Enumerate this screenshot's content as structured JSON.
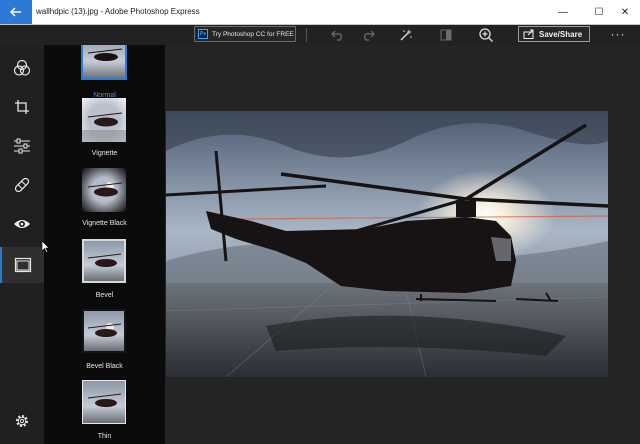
{
  "window": {
    "title": "wallhdpic (13).jpg - Adobe Photoshop Express",
    "minimize": "—",
    "maximize": "☐",
    "close": "✕"
  },
  "toolbar": {
    "try_badge": "Ps",
    "try_label": "Try Photoshop CC for FREE",
    "save_label": "Save/Share",
    "more": "···"
  },
  "icons": {
    "back": "back-arrow-icon",
    "undo": "undo-icon",
    "redo": "redo-icon",
    "auto_fix": "magic-wand-icon",
    "compare": "compare-icon",
    "zoom": "zoom-in-icon",
    "share": "share-icon"
  },
  "tools": [
    {
      "name": "looks",
      "icon": "looks-circles-icon"
    },
    {
      "name": "crop",
      "icon": "crop-icon"
    },
    {
      "name": "adjust",
      "icon": "sliders-icon"
    },
    {
      "name": "heal",
      "icon": "bandage-icon"
    },
    {
      "name": "red-eye",
      "icon": "eye-icon"
    },
    {
      "name": "borders",
      "icon": "border-frame-icon",
      "active": true
    },
    {
      "name": "settings",
      "icon": "gear-icon"
    }
  ],
  "presets": [
    {
      "label": "Normal",
      "selected": true
    },
    {
      "label": "Vignette"
    },
    {
      "label": "Vignette Black"
    },
    {
      "label": "Bevel"
    },
    {
      "label": "Bevel Black"
    },
    {
      "label": "Thin"
    }
  ],
  "colors": {
    "accent": "#2b7bd6",
    "selected_label": "#4d8fdd",
    "panel_bg": "#0b0b0b",
    "canvas_bg": "#242424"
  }
}
